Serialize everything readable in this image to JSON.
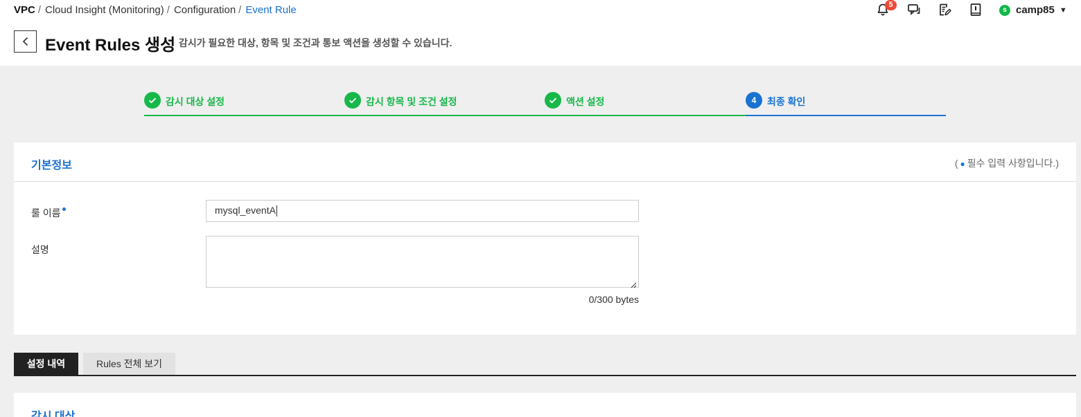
{
  "breadcrumb": {
    "items": [
      "VPC",
      "Cloud Insight (Monitoring)",
      "Configuration",
      "Event Rule"
    ],
    "separator": "/"
  },
  "header_icons": {
    "notification_count": "5",
    "icons": [
      "bell-icon",
      "chat-icon",
      "edit-note-icon",
      "book-icon"
    ]
  },
  "user": {
    "initial": "s",
    "name": "camp85",
    "caret": "▼"
  },
  "page": {
    "title": "Event Rules 생성",
    "description": "감시가 필요한 대상, 항목 및 조건과 통보 액션을 생성할 수 있습니다."
  },
  "steps": [
    {
      "label": "감시 대상 설정",
      "status": "done"
    },
    {
      "label": "감시 항목 및 조건 설정",
      "status": "done"
    },
    {
      "label": "액션 설정",
      "status": "done"
    },
    {
      "label": "최종 확인",
      "status": "active",
      "number": "4"
    }
  ],
  "basic_info": {
    "title": "기본정보",
    "required_note_open": "(",
    "required_note_text": "필수 입력 사항입니다.)",
    "rule_name_label": "룰 이름",
    "rule_name_value": "mysql_eventA",
    "description_label": "설명",
    "description_value": "",
    "byte_count": "0/300 bytes"
  },
  "tabs": [
    {
      "label": "설정 내역",
      "active": true
    },
    {
      "label": "Rules 전체 보기",
      "active": false
    }
  ],
  "section2": {
    "title": "감시 대상"
  },
  "colors": {
    "accent_blue": "#1a73d0",
    "done_green": "#17b84a",
    "badge_red": "#ec4a35",
    "background_gray": "#efefef"
  }
}
